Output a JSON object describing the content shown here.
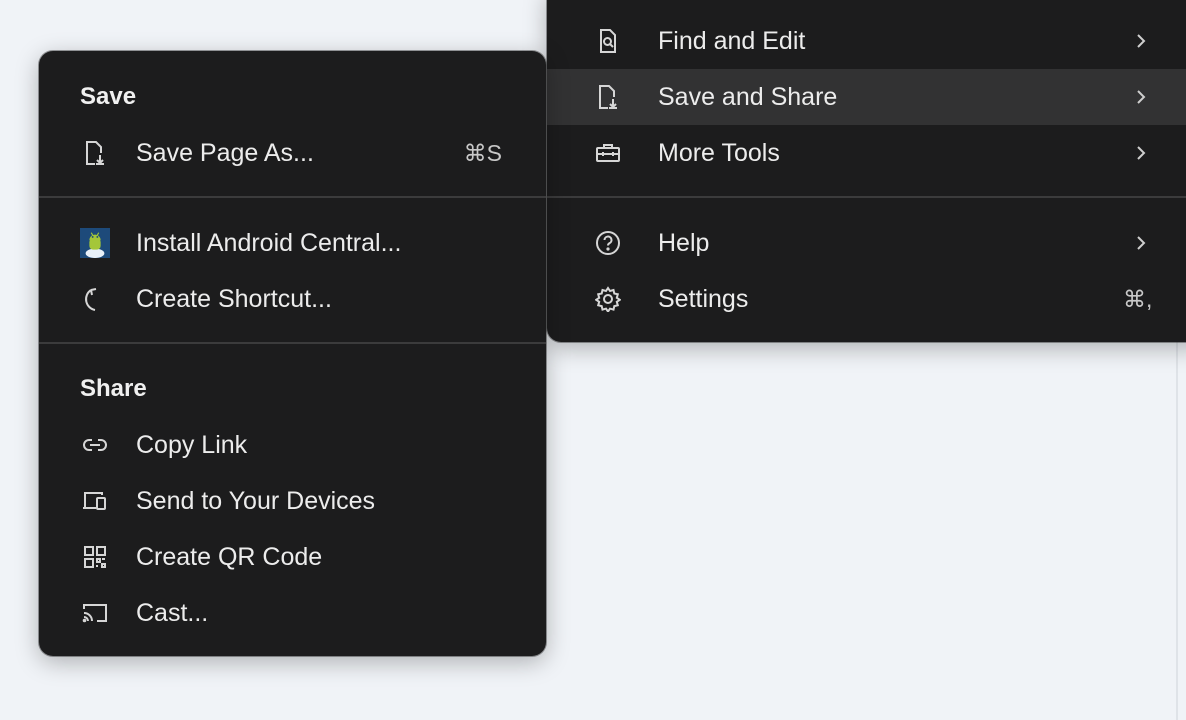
{
  "main_menu": {
    "items": [
      {
        "label": "Find and Edit",
        "icon": "find-in-page-icon",
        "submenu": true
      },
      {
        "label": "Save and Share",
        "icon": "save-page-icon",
        "submenu": true,
        "highlighted": true
      },
      {
        "label": "More Tools",
        "icon": "toolbox-icon",
        "submenu": true
      },
      {
        "label": "Help",
        "icon": "help-circle-icon",
        "submenu": true
      },
      {
        "label": "Settings",
        "icon": "gear-icon",
        "shortcut": "⌘,"
      }
    ]
  },
  "submenu": {
    "save_heading": "Save",
    "save_items": [
      {
        "label": "Save Page As...",
        "icon": "save-page-icon",
        "shortcut": "⌘S"
      },
      {
        "label": "Install Android Central...",
        "icon": "android-central-app-icon"
      },
      {
        "label": "Create Shortcut...",
        "icon": "shortcut-arrow-icon"
      }
    ],
    "share_heading": "Share",
    "share_items": [
      {
        "label": "Copy Link",
        "icon": "link-icon"
      },
      {
        "label": "Send to Your Devices",
        "icon": "devices-icon"
      },
      {
        "label": "Create QR Code",
        "icon": "qr-code-icon"
      },
      {
        "label": "Cast...",
        "icon": "cast-icon"
      }
    ]
  },
  "colors": {
    "menu_background": "#1c1c1d",
    "highlight": "#323233",
    "text": "#ececec",
    "page_background": "#f0f3f7"
  }
}
